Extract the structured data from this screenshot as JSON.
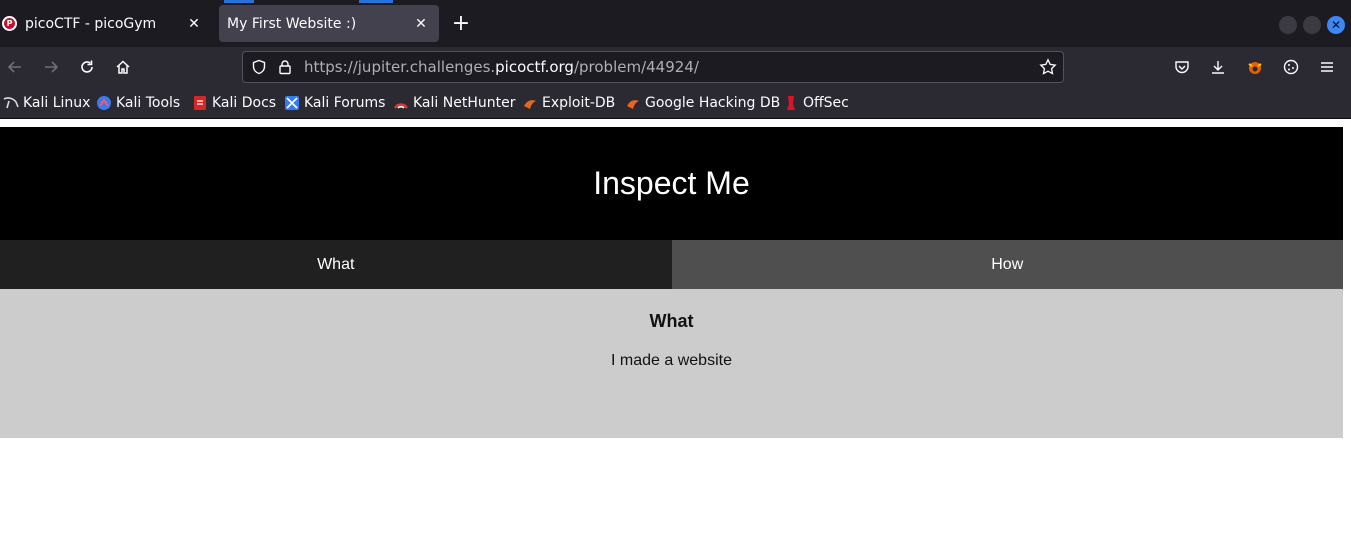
{
  "browser": {
    "tabs": [
      {
        "title": "picoCTF - picoGym",
        "active": false
      },
      {
        "title": "My First Website :)",
        "active": true
      }
    ],
    "url": {
      "prefix": "https://jupiter.challenges.",
      "domain": "picoctf.org",
      "path": "/problem/44924/"
    },
    "bookmarks": [
      {
        "label": "Kali Linux",
        "icon": "kali-dragon-icon"
      },
      {
        "label": "Kali Tools",
        "icon": "kali-tools-icon"
      },
      {
        "label": "Kali Docs",
        "icon": "kali-docs-icon"
      },
      {
        "label": "Kali Forums",
        "icon": "kali-forums-icon"
      },
      {
        "label": "Kali NetHunter",
        "icon": "nethunter-icon"
      },
      {
        "label": "Exploit-DB",
        "icon": "exploit-db-icon"
      },
      {
        "label": "Google Hacking DB",
        "icon": "ghdb-icon"
      },
      {
        "label": "OffSec",
        "icon": "offsec-icon"
      }
    ],
    "colors": {
      "accent": "#3d86f6",
      "toolbar": "#2b2a33",
      "titlebar": "#1c1b22"
    }
  },
  "site": {
    "title": "Inspect Me",
    "tabs": [
      {
        "label": "What",
        "active": true
      },
      {
        "label": "How",
        "active": false
      }
    ],
    "section": {
      "heading": "What",
      "text": "I made a website"
    }
  }
}
